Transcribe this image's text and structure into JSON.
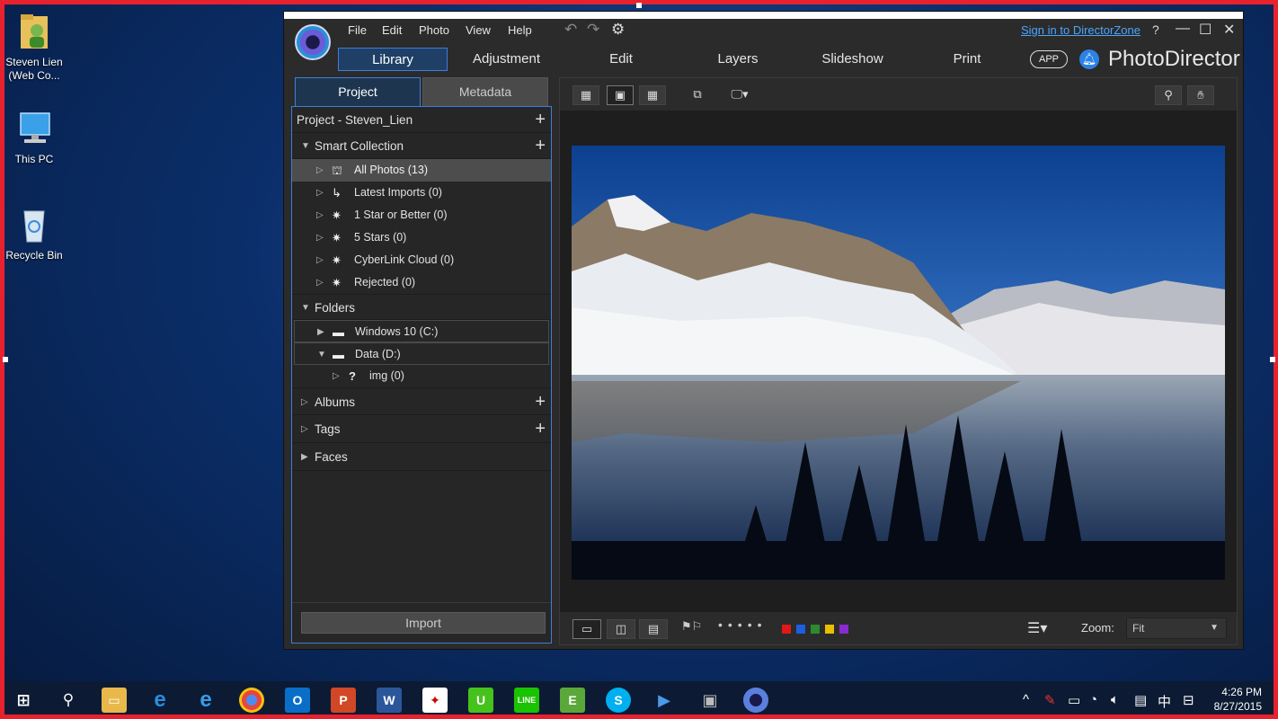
{
  "desktop": {
    "icons": [
      {
        "label": "Steven Lien (Web Co..."
      },
      {
        "label": "This PC"
      },
      {
        "label": "Recycle Bin"
      }
    ]
  },
  "app": {
    "menu": {
      "file": "File",
      "edit": "Edit",
      "photo": "Photo",
      "view": "View",
      "help": "Help"
    },
    "sign_in": "Sign in to DirectorZone",
    "help_glyph": "?",
    "modes": {
      "library": "Library",
      "adjustment": "Adjustment",
      "edit": "Edit",
      "layers": "Layers",
      "slideshow": "Slideshow",
      "print": "Print"
    },
    "app_button": "APP",
    "brand": "PhotoDirector",
    "panel_tabs": {
      "project": "Project",
      "metadata": "Metadata"
    },
    "tree": {
      "project": "Project - Steven_Lien",
      "smart_collection": "Smart Collection",
      "smart_items": [
        {
          "label": "All Photos (13)"
        },
        {
          "label": "Latest Imports (0)"
        },
        {
          "label": "1 Star or Better (0)"
        },
        {
          "label": "5 Stars (0)"
        },
        {
          "label": "CyberLink Cloud (0)"
        },
        {
          "label": "Rejected (0)"
        }
      ],
      "folders": "Folders",
      "folder_items": [
        {
          "label": "Windows 10 (C:)"
        },
        {
          "label": "Data (D:)"
        },
        {
          "label": "img (0)"
        }
      ],
      "albums": "Albums",
      "tags": "Tags",
      "faces": "Faces"
    },
    "import_button": "Import",
    "zoom": {
      "label": "Zoom:",
      "value": "Fit"
    },
    "color_labels": [
      "#e01818",
      "#1c5fe0",
      "#2e8a2e",
      "#e8c000",
      "#8a2ad0"
    ]
  },
  "taskbar": {
    "time": "4:26 PM",
    "date": "8/27/2015",
    "ime": "中"
  }
}
